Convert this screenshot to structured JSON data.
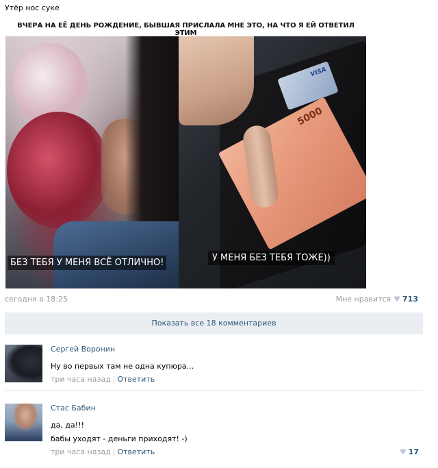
{
  "post": {
    "text": "Утёр нос суке",
    "date": "сегодня в 18:25",
    "likes_label": "Мне нравится",
    "likes_count": "713"
  },
  "meme": {
    "caption": "ВЧЕРА НА ЕЁ ДЕНЬ РОЖДЕНИЕ, БЫВШАЯ ПРИСЛАЛА МНЕ ЭТО, НА ЧТО Я ЕЙ ОТВЕТИЛ ЭТИМ",
    "left_text": "БЕЗ ТЕБЯ У МЕНЯ ВСЁ ОТЛИЧНО!",
    "right_text": "У МЕНЯ БЕЗ ТЕБЯ ТОЖЕ))",
    "card_brand": "VISA",
    "banknote_value": "5000"
  },
  "comments_bar": {
    "label": "Показать все 18 комментариев"
  },
  "comments": [
    {
      "author": "Сергей Воронин",
      "lines": [
        "Ну во первых там не одна купюра..."
      ],
      "time": "три часа назад",
      "reply": "Ответить"
    },
    {
      "author": "Стас Бабин",
      "lines": [
        "да, да!!!",
        "бабы уходят - деньги приходят! -)"
      ],
      "time": "три часа назад",
      "reply": "Ответить",
      "likes": "17"
    }
  ],
  "icons": {
    "like": "heart-icon"
  },
  "colors": {
    "link": "#2b587a",
    "muted": "#999999",
    "bar_bg": "#eaeef3"
  }
}
